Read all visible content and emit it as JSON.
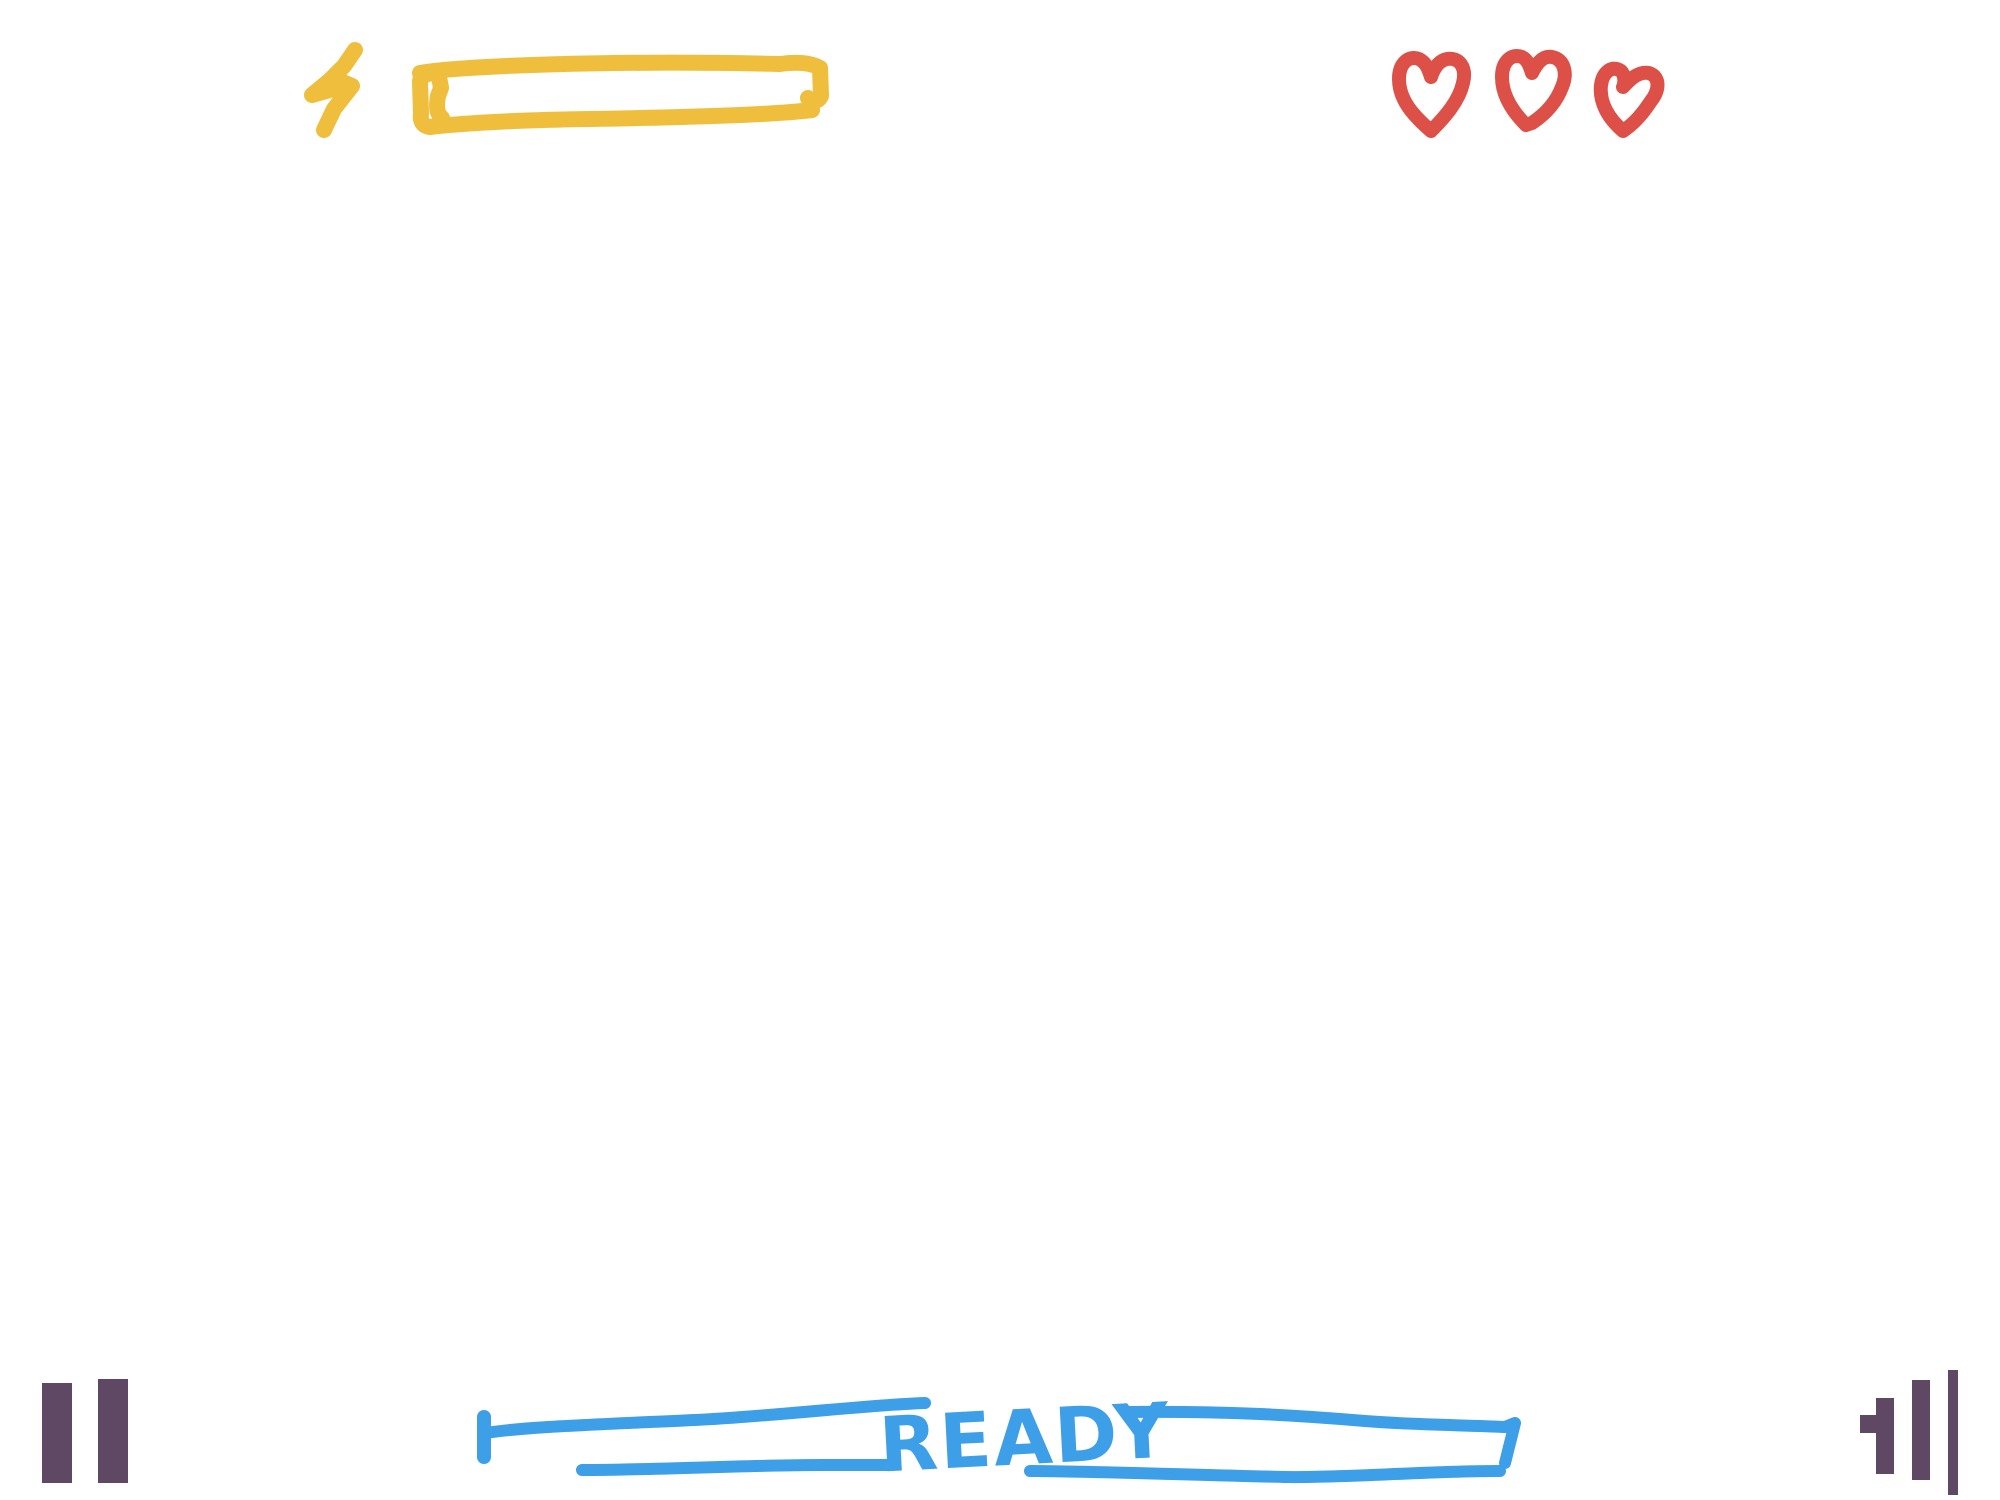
{
  "colors": {
    "energy": "#eebe3c",
    "hearts": "#dc5047",
    "ready": "#3d9fe8",
    "controls": "#5e4864",
    "background": "#ffffff"
  },
  "hud": {
    "energy": {
      "icon": "lightning-bolt-icon",
      "level": 1.0
    },
    "lives": {
      "icon": "heart-icon",
      "count": 3
    }
  },
  "controls": {
    "pause": {
      "icon": "pause-icon"
    },
    "signal": {
      "icon": "signal-bars-icon"
    }
  },
  "status": {
    "label": "READY"
  }
}
